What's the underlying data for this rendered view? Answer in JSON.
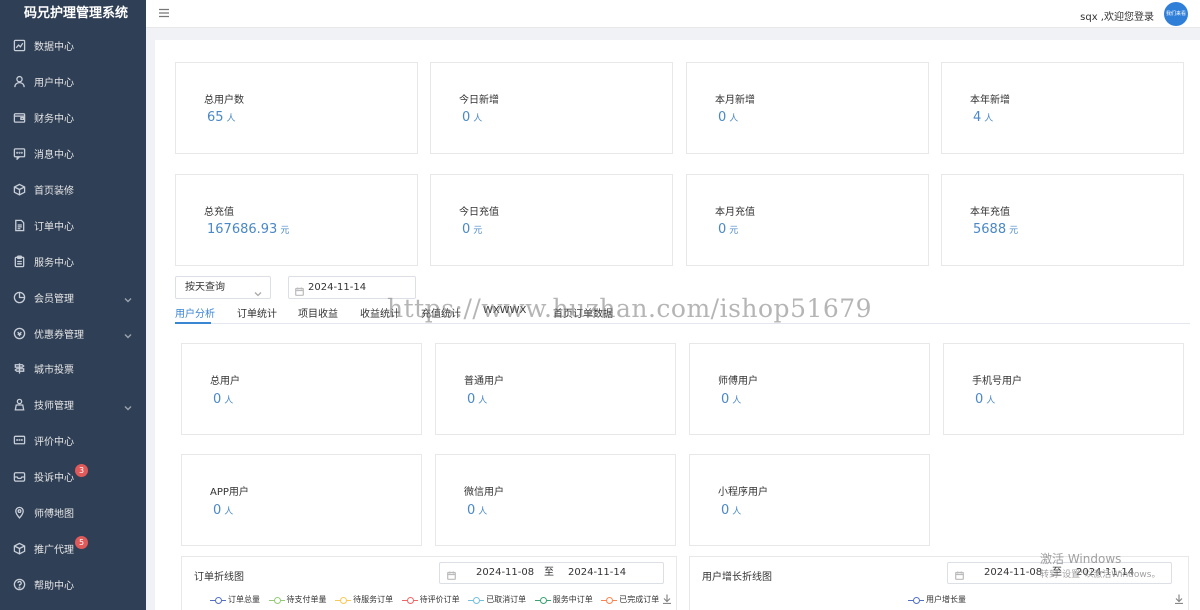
{
  "app": {
    "title": "码兄护理管理系统"
  },
  "header": {
    "welcome": "sqx ,欢迎您登录",
    "avatar_text": "我们来看"
  },
  "sidebar": {
    "items": [
      {
        "label": "数据中心",
        "icon": "chart-icon"
      },
      {
        "label": "用户中心",
        "icon": "user-icon"
      },
      {
        "label": "财务中心",
        "icon": "wallet-icon"
      },
      {
        "label": "消息中心",
        "icon": "message-icon"
      },
      {
        "label": "首页装修",
        "icon": "box-icon"
      },
      {
        "label": "订单中心",
        "icon": "document-icon"
      },
      {
        "label": "服务中心",
        "icon": "clipboard-icon"
      },
      {
        "label": "会员管理",
        "icon": "member-icon"
      },
      {
        "label": "优惠券管理",
        "icon": "coupon-icon"
      },
      {
        "label": "城市投票",
        "icon": "signpost-icon"
      },
      {
        "label": "技师管理",
        "icon": "technician-icon"
      },
      {
        "label": "评价中心",
        "icon": "comment-icon"
      },
      {
        "label": "投诉中心",
        "icon": "complaint-icon",
        "badge": "3"
      },
      {
        "label": "师傅地图",
        "icon": "map-pin-icon"
      },
      {
        "label": "推广代理",
        "icon": "cube-icon",
        "badge": "5"
      },
      {
        "label": "帮助中心",
        "icon": "help-icon"
      }
    ]
  },
  "summary_row1": [
    {
      "title": "总用户数",
      "value": "65",
      "unit": "人"
    },
    {
      "title": "今日新增",
      "value": "0",
      "unit": "人"
    },
    {
      "title": "本月新增",
      "value": "0",
      "unit": "人"
    },
    {
      "title": "本年新增",
      "value": "4",
      "unit": "人"
    }
  ],
  "summary_row2": [
    {
      "title": "总充值",
      "value": "167686.93",
      "unit": "元"
    },
    {
      "title": "今日充值",
      "value": "0",
      "unit": "元"
    },
    {
      "title": "本月充值",
      "value": "0",
      "unit": "元"
    },
    {
      "title": "本年充值",
      "value": "5688",
      "unit": "元"
    }
  ],
  "filter": {
    "mode": "按天查询",
    "date": "2024-11-14"
  },
  "tabs": [
    "用户分析",
    "订单统计",
    "项目收益",
    "收益统计",
    "充值统计",
    "WXWWX",
    "首页订单数据"
  ],
  "watermark": "https://www.huzhan.com/ishop51679",
  "user_row1": [
    {
      "title": "总用户",
      "value": "0",
      "unit": "人"
    },
    {
      "title": "普通用户",
      "value": "0",
      "unit": "人"
    },
    {
      "title": "师傅用户",
      "value": "0",
      "unit": "人"
    },
    {
      "title": "手机号用户",
      "value": "0",
      "unit": "人"
    }
  ],
  "user_row2": [
    {
      "title": "APP用户",
      "value": "0",
      "unit": "人"
    },
    {
      "title": "微信用户",
      "value": "0",
      "unit": "人"
    },
    {
      "title": "小程序用户",
      "value": "0",
      "unit": "人"
    }
  ],
  "order_chart": {
    "title": "订单折线图",
    "start": "2024-11-08",
    "sep": "至",
    "end": "2024-11-14",
    "legend": [
      {
        "name": "订单总量",
        "color": "#5470c6"
      },
      {
        "name": "待支付单量",
        "color": "#91cc75"
      },
      {
        "name": "待服务订单",
        "color": "#fac858"
      },
      {
        "name": "待评价订单",
        "color": "#ee6666"
      },
      {
        "name": "已取消订单",
        "color": "#73c0de"
      },
      {
        "name": "服务中订单",
        "color": "#3ba272"
      },
      {
        "name": "已完成订单",
        "color": "#fc8452"
      }
    ]
  },
  "user_chart": {
    "title": "用户增长折线图",
    "start": "2024-11-08",
    "sep": "至",
    "end": "2024-11-14",
    "legend": [
      {
        "name": "用户增长量",
        "color": "#5470c6"
      }
    ]
  },
  "system": {
    "activate": "激活 Windows",
    "activate_sub": "转到\"设置\"以激活Windows。"
  }
}
